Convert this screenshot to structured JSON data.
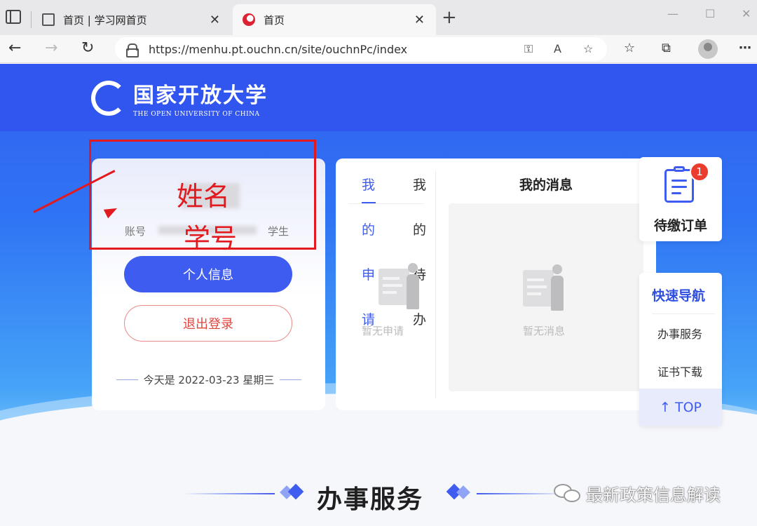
{
  "browser": {
    "tabs": [
      {
        "title": "首页 | 学习网首页"
      },
      {
        "title": "首页"
      }
    ],
    "tab_close": "✕",
    "new_tab": "+",
    "window": {
      "minimize": "—",
      "maximize": "☐",
      "close": "✕"
    },
    "url": "https://menhu.pt.ouchn.cn/site/ouchnPc/index",
    "icons": [
      "back-icon",
      "forward-icon",
      "refresh-icon",
      "lock-icon",
      "key-icon",
      "read-aloud-icon",
      "add-favorite-icon",
      "favorites-icon",
      "collections-icon",
      "profile-icon",
      "more-icon"
    ]
  },
  "site": {
    "logo_cn": "国家开放大学",
    "logo_en": "THE OPEN UNIVERSITY OF CHINA"
  },
  "user_card": {
    "account_label": "账号",
    "role": "学生",
    "annotation_name": "姓名",
    "annotation_id": "学号",
    "personal_info_button": "个人信息",
    "logout_button": "退出登录",
    "today": "今天是 2022-03-23 星期三"
  },
  "panel": {
    "tab_my_applications": [
      "我",
      "的",
      "申",
      "请"
    ],
    "tab_my_todo": [
      "我",
      "的",
      "待",
      "办"
    ],
    "applications_empty": "暂无申请",
    "messages_title": "我的消息",
    "messages_empty": "暂无消息"
  },
  "sidebar": {
    "pending_orders_label": "待缴订单",
    "pending_orders_count": "1",
    "quick_nav_title": "快速导航",
    "quick_nav_items": [
      "办事服务",
      "证书下载"
    ],
    "top_button": "↑ TOP"
  },
  "section": {
    "title": "办事服务"
  },
  "watermark": "最新政策信息解读",
  "colors": {
    "brand_blue": "#3e5cf0",
    "logout_red": "#e0453e",
    "annotation_red": "#e2191e",
    "badge_red": "#ec3b2f"
  }
}
